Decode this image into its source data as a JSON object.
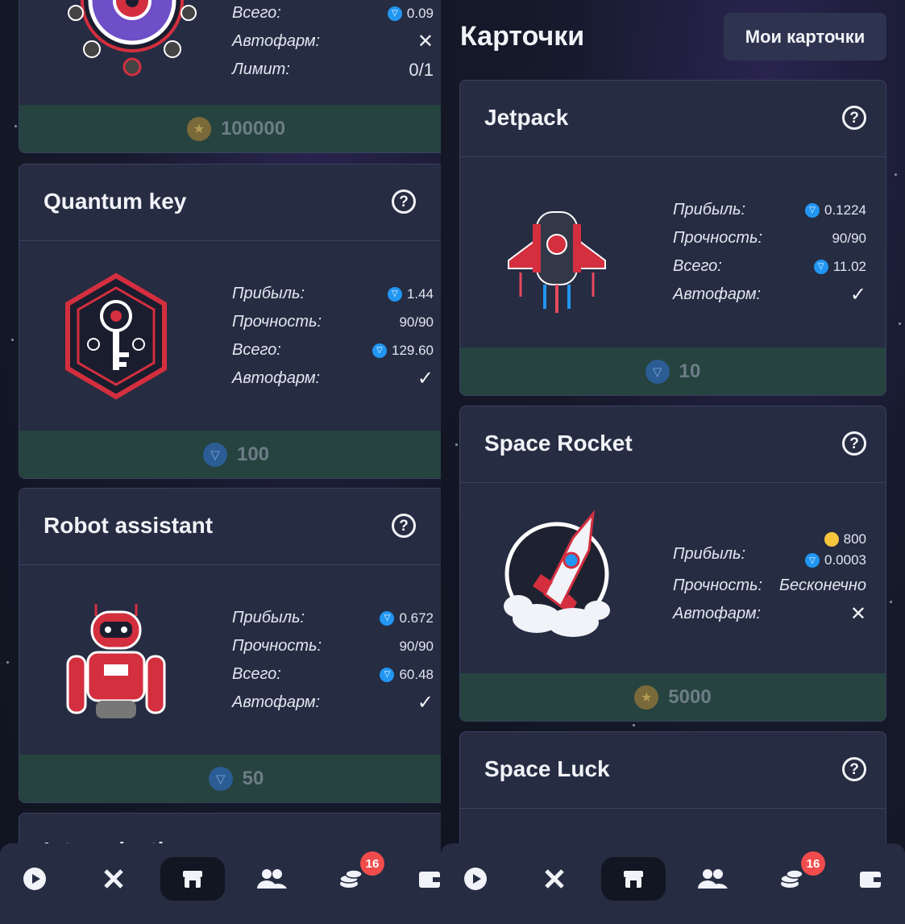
{
  "left_panel": {
    "card_top": {
      "rows": [
        {
          "label": "Всего:",
          "value": "0.09",
          "currency": "ton"
        },
        {
          "label": "Автофарм:",
          "value": "✕",
          "type": "cross"
        },
        {
          "label": "Лимит:",
          "value": "0/1",
          "type": "text"
        }
      ],
      "price": "100000"
    },
    "card_quantum": {
      "title": "Quantum key",
      "rows": [
        {
          "label": "Прибыль:",
          "value": "1.44"
        },
        {
          "label": "Прочность:",
          "value": "90/90"
        },
        {
          "label": "Всего:",
          "value": "129.60"
        },
        {
          "label": "Автофарм:",
          "value": "✓"
        }
      ],
      "price": "100"
    },
    "card_robot": {
      "title": "Robot assistant",
      "rows": [
        {
          "label": "Прибыль:",
          "value": "0.672"
        },
        {
          "label": "Прочность:",
          "value": "90/90"
        },
        {
          "label": "Всего:",
          "value": "60.48"
        },
        {
          "label": "Автофарм:",
          "value": "✓"
        }
      ],
      "price": "50"
    },
    "card_partial_title": "Intergalactic"
  },
  "right_panel": {
    "page_title": "Карточки",
    "my_cards_button": "Мои карточки",
    "card_jetpack": {
      "title": "Jetpack",
      "rows": [
        {
          "label": "Прибыль:",
          "value": "0.1224"
        },
        {
          "label": "Прочность:",
          "value": "90/90"
        },
        {
          "label": "Всего:",
          "value": "11.02"
        },
        {
          "label": "Автофарм:",
          "value": "✓"
        }
      ],
      "price": "10"
    },
    "card_rocket": {
      "title": "Space Rocket",
      "profit_coin": "800",
      "profit_ton": "0.0003",
      "rows": [
        {
          "label": "Прибыль:"
        },
        {
          "label": "Прочность:",
          "value": "Бесконечно"
        },
        {
          "label": "Автофарм:",
          "value": "✕"
        }
      ],
      "price": "5000"
    },
    "card_luck": {
      "title": "Space Luck"
    }
  },
  "nav": {
    "items": [
      "play",
      "tools",
      "shop",
      "friends",
      "coins",
      "wallet"
    ],
    "active": "shop",
    "badge": "16"
  },
  "colors": {
    "card_bg": "#262c42",
    "footer_bg": "#26433f",
    "ton_blue": "#2196f3",
    "badge_red": "#f04c4c",
    "accent_red": "#d32f3f"
  }
}
